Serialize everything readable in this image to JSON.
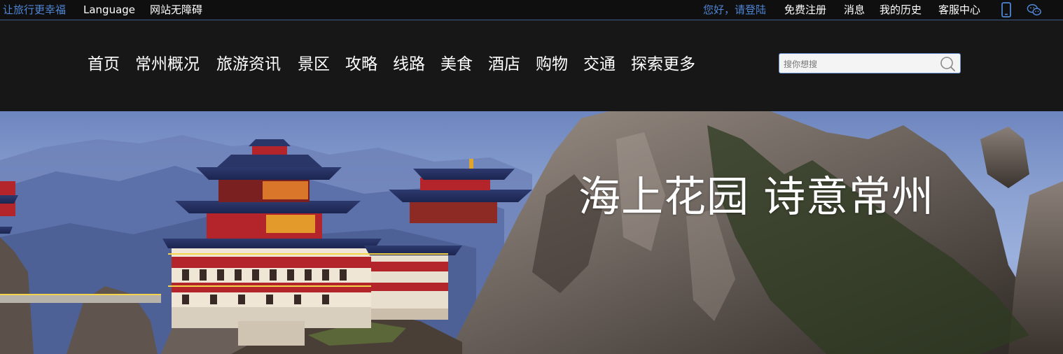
{
  "topbar": {
    "slogan": "让旅行更幸福",
    "language": "Language",
    "accessibility": "网站无障碍",
    "greeting": "您好，请登陆",
    "register": "免费注册",
    "messages": "消息",
    "history": "我的历史",
    "service": "客服中心",
    "icons": [
      "mobile-icon",
      "wechat-icon"
    ]
  },
  "nav": {
    "items": [
      "首页",
      "常州概况",
      "旅游资讯",
      "景区",
      "攻略",
      "线路",
      "美食",
      "酒店",
      "购物",
      "交通",
      "探索更多"
    ]
  },
  "search": {
    "placeholder": "搜你想搜",
    "value": ""
  },
  "hero": {
    "title": "海上花园 诗意常州"
  },
  "colors": {
    "accent_blue": "#4f86d6",
    "topbar_bg": "#0f0f0f",
    "header_bg": "#171717"
  }
}
